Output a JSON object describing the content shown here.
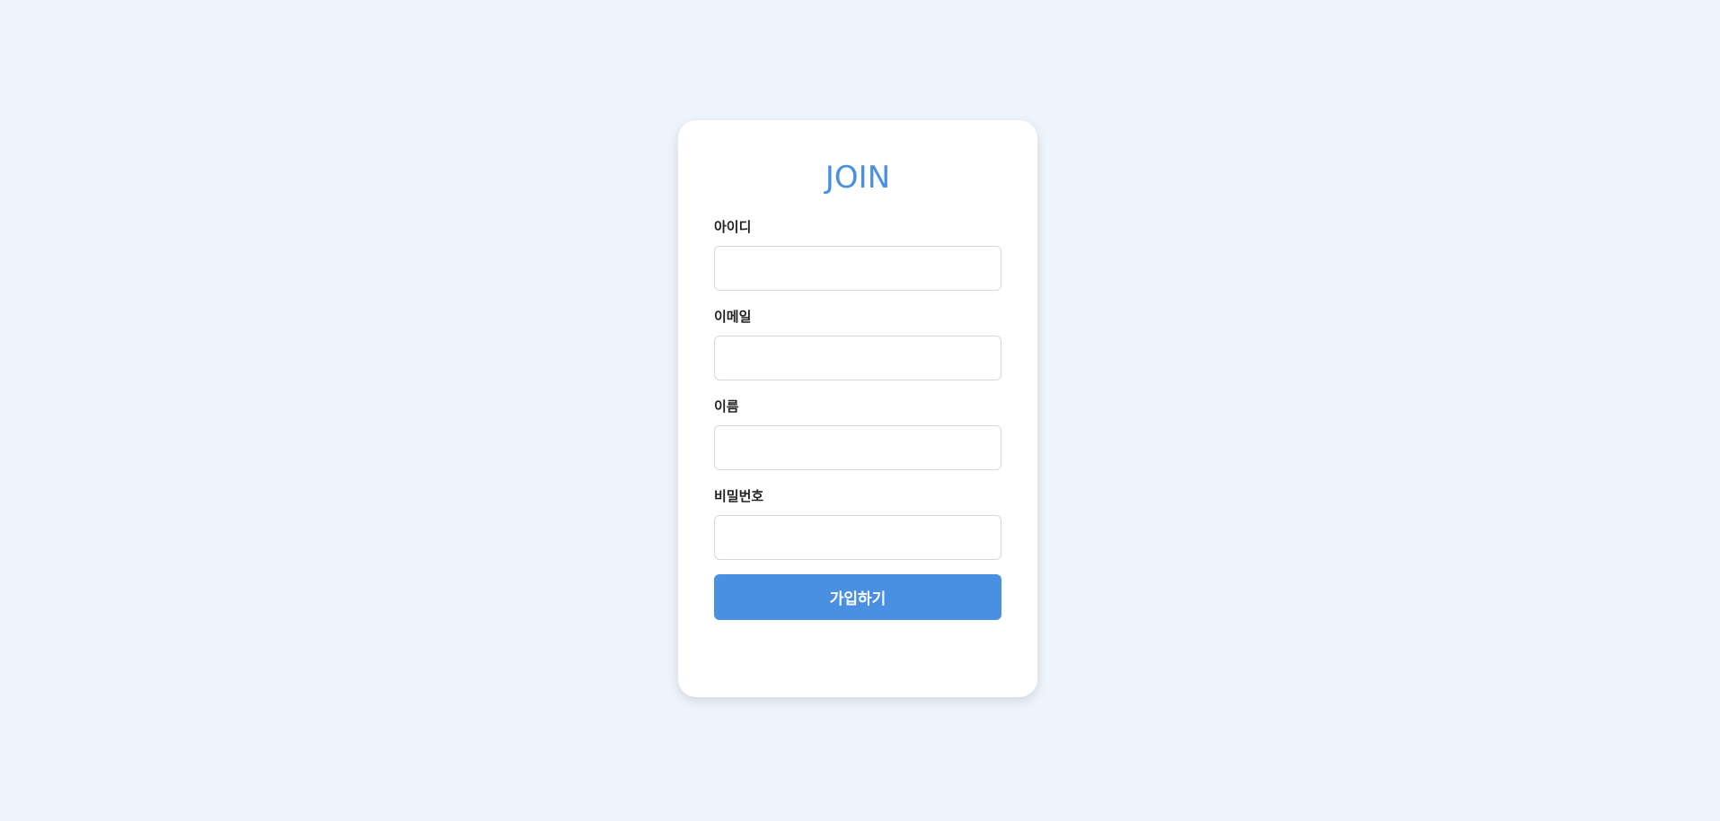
{
  "page": {
    "background_color": "#edf4fb"
  },
  "card": {
    "title": "JOIN",
    "accent_color": "#4a90e2"
  },
  "form": {
    "fields": [
      {
        "label": "아이디",
        "value": "",
        "placeholder": ""
      },
      {
        "label": "이메일",
        "value": "",
        "placeholder": ""
      },
      {
        "label": "이름",
        "value": "",
        "placeholder": ""
      },
      {
        "label": "비밀번호",
        "value": "",
        "placeholder": ""
      }
    ],
    "submit_label": "가입하기"
  }
}
